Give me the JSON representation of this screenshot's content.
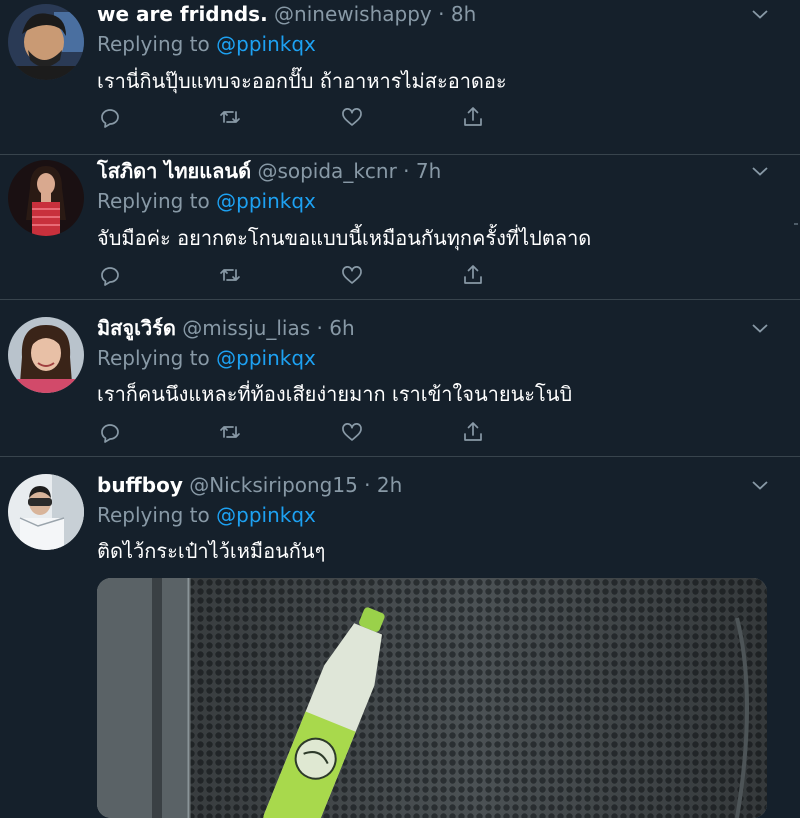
{
  "tweets": [
    {
      "name": "we are fridnds.",
      "handle": "@ninewishappy",
      "time": "8h",
      "replying_prefix": "Replying to",
      "replying_to": "@ppinkqx",
      "text": "เรานี่กินปุ๊บแทบจะออกปั๊บ ถ้าอาหารไม่สะอาดอะ"
    },
    {
      "name": "โสภิดา ไทยแลนด์",
      "handle": "@sopida_kcnr",
      "time": "7h",
      "replying_prefix": "Replying to",
      "replying_to": "@ppinkqx",
      "text": "จับมือค่ะ อยากตะโกนขอแบบนี้เหมือนกันทุกครั้งที่ไปตลาด"
    },
    {
      "name": "มิสจูเวิร์ด",
      "handle": "@missju_lias",
      "time": "6h",
      "replying_prefix": "Replying to",
      "replying_to": "@ppinkqx",
      "text": "เราก็คนนึงแหละที่ท้องเสียง่ายมาก เราเข้าใจนายนะโนบิ"
    },
    {
      "name": "buffboy",
      "handle": "@Nicksiripong15",
      "time": "2h",
      "replying_prefix": "Replying to",
      "replying_to": "@ppinkqx",
      "text": "ติดไว้กระเป๋าไว้เหมือนกันๆ"
    }
  ],
  "separator": " · ",
  "icons": [
    "reply-icon",
    "retweet-icon",
    "like-icon",
    "share-icon",
    "chevron-down-icon"
  ],
  "colors": {
    "background": "#15202b",
    "text": "#ffffff",
    "muted": "#8899a6",
    "link": "#1da1f2",
    "divider": "#38444d"
  }
}
